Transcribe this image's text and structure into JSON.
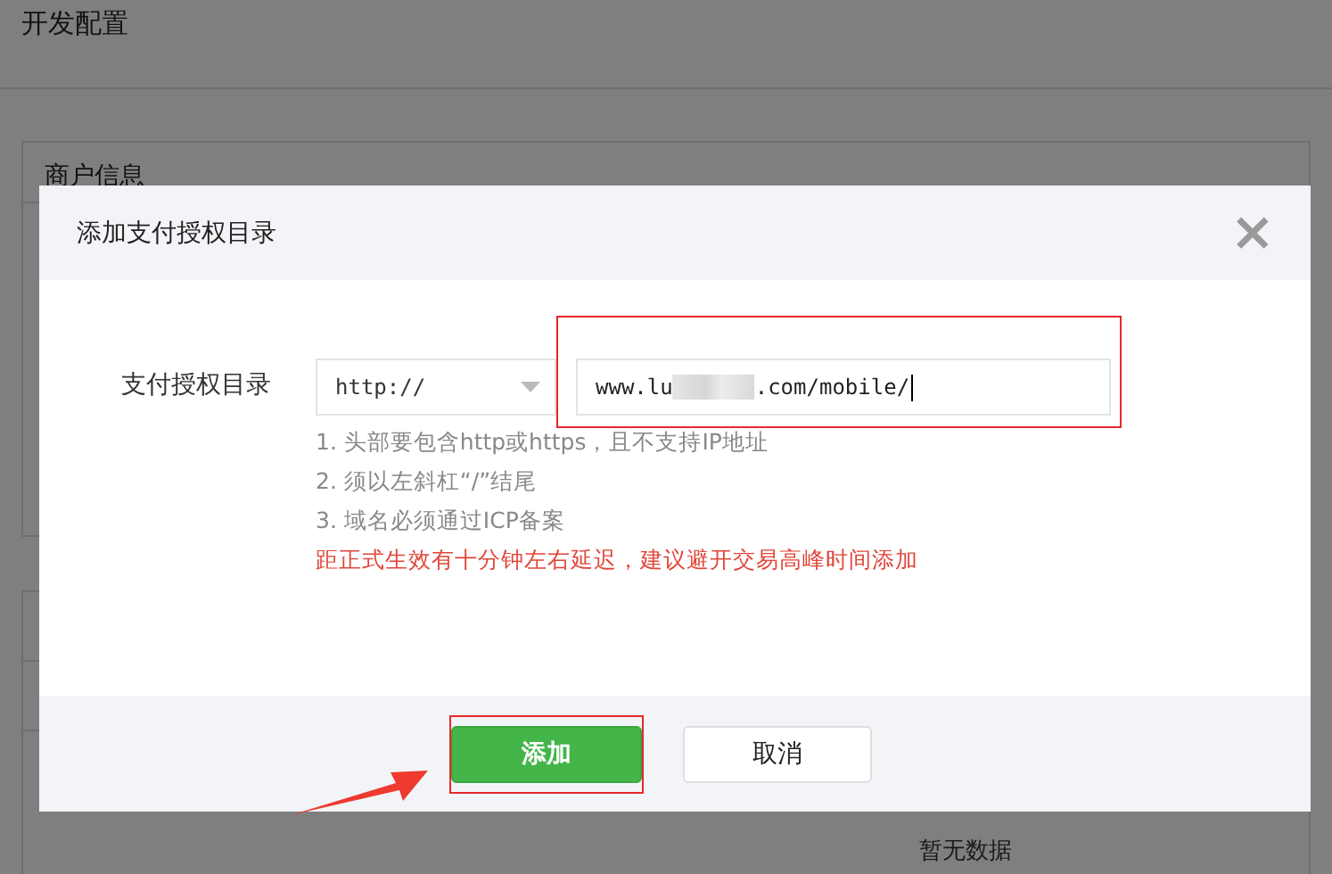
{
  "page": {
    "title": "开发配置",
    "panel_title": "商户信息",
    "empty_text": "暂无数据"
  },
  "dialog": {
    "title": "添加支付授权目录",
    "close": "×",
    "field_label": "支付授权目录",
    "protocol": {
      "value": "http://"
    },
    "url_field": {
      "value_before_blur": "www.lu",
      "value_after_blur": ".com/mobile/",
      "focused": true
    },
    "hints": [
      {
        "text": "1. 头部要包含http或https，且不支持IP地址",
        "kind": "note"
      },
      {
        "text": "2. 须以左斜杠“/”结尾",
        "kind": "note"
      },
      {
        "text": "3. 域名必须通过ICP备案",
        "kind": "note"
      },
      {
        "text": "距正式生效有十分钟左右延迟，建议避开交易高峰时间添加",
        "kind": "warning"
      }
    ],
    "buttons": [
      {
        "label": "添加",
        "kind": "primary"
      },
      {
        "label": "取消",
        "kind": "default"
      }
    ]
  }
}
